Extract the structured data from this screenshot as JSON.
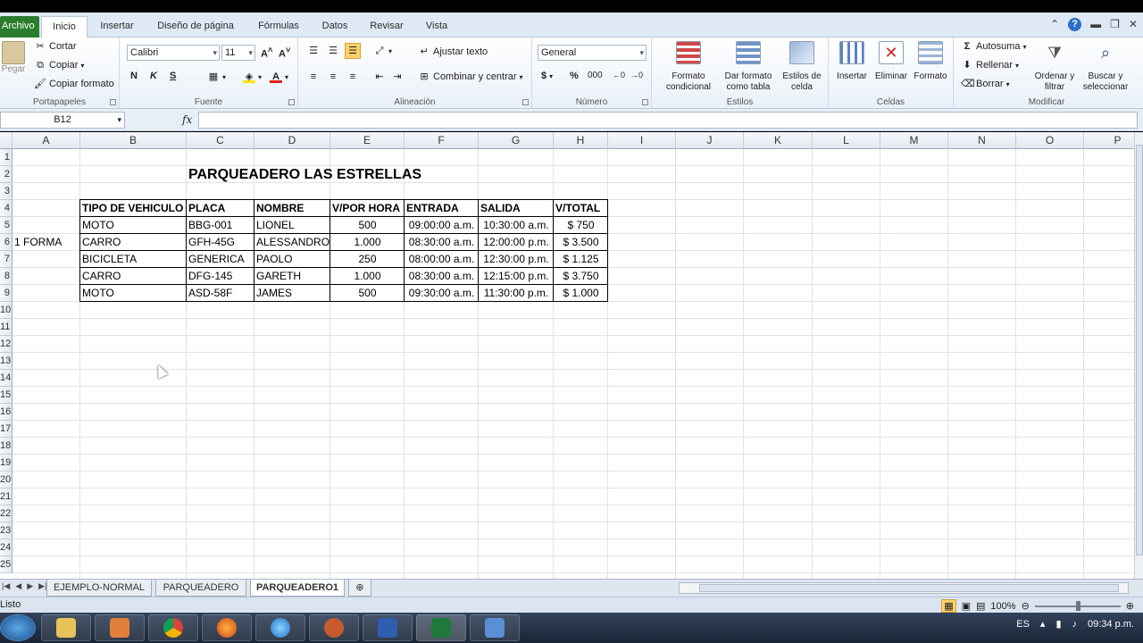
{
  "ribbon_tabs": {
    "file": "Archivo",
    "inicio": "Inicio",
    "insertar": "Insertar",
    "diseno": "Diseño de página",
    "formulas": "Fórmulas",
    "datos": "Datos",
    "revisar": "Revisar",
    "vista": "Vista"
  },
  "clipboard": {
    "paste": "Pegar",
    "cut": "Cortar",
    "copy": "Copiar",
    "format_painter": "Copiar formato",
    "label": "Portapapeles"
  },
  "font": {
    "name": "Calibri",
    "size": "11",
    "bold": "N",
    "italic": "K",
    "underline": "S",
    "label": "Fuente"
  },
  "alignment": {
    "wrap": "Ajustar texto",
    "merge": "Combinar y centrar",
    "label": "Alineación"
  },
  "number": {
    "format": "General",
    "currency": "$",
    "percent": "%",
    "thousands": "000",
    "label": "Número"
  },
  "styles": {
    "conditional": "Formato condicional",
    "as_table": "Dar formato como tabla",
    "cell_styles": "Estilos de celda",
    "label": "Estilos"
  },
  "cells": {
    "insert": "Insertar",
    "delete": "Eliminar",
    "format": "Formato",
    "label": "Celdas"
  },
  "editing": {
    "autosum": "Autosuma",
    "fill": "Rellenar",
    "clear": "Borrar",
    "sort": "Ordenar y filtrar",
    "find": "Buscar y seleccionar",
    "label": "Modificar"
  },
  "formula_bar": {
    "name_box": "B12",
    "fx": "fx",
    "content": ""
  },
  "columns": [
    "A",
    "B",
    "C",
    "D",
    "E",
    "F",
    "G",
    "H",
    "I",
    "J",
    "K",
    "L",
    "M",
    "N",
    "O",
    "P"
  ],
  "rows": [
    "1",
    "2",
    "3",
    "4",
    "5",
    "6",
    "7",
    "8",
    "9",
    "10",
    "11",
    "12",
    "13",
    "14",
    "15",
    "16",
    "17",
    "18",
    "19",
    "20",
    "21",
    "22",
    "23",
    "24",
    "25"
  ],
  "sheet": {
    "title": "PARQUEADERO LAS ESTRELLAS",
    "side_label": "1 FORMA",
    "headers": [
      "TIPO DE VEHICULO",
      "PLACA",
      "NOMBRE",
      "V/POR HORA",
      "ENTRADA",
      "SALIDA",
      "V/TOTAL"
    ],
    "data": [
      [
        "MOTO",
        "BBG-001",
        "LIONEL",
        "500",
        "09:00:00 a.m.",
        "10:30:00 a.m.",
        "$ 750"
      ],
      [
        "CARRO",
        "GFH-45G",
        "ALESSANDRO",
        "1.000",
        "08:30:00 a.m.",
        "12:00:00 p.m.",
        "$ 3.500"
      ],
      [
        "BICICLETA",
        "GENERICA",
        "PAOLO",
        "250",
        "08:00:00 a.m.",
        "12:30:00 p.m.",
        "$ 1.125"
      ],
      [
        "CARRO",
        "DFG-145",
        "GARETH",
        "1.000",
        "08:30:00 a.m.",
        "12:15:00 p.m.",
        "$ 3.750"
      ],
      [
        "MOTO",
        "ASD-58F",
        "JAMES",
        "500",
        "09:30:00 a.m.",
        "11:30:00 p.m.",
        "$ 1.000"
      ]
    ]
  },
  "sheet_tabs": [
    "EJEMPLO-NORMAL",
    "PARQUEADERO",
    "PARQUEADERO1"
  ],
  "active_sheet": "PARQUEADERO1",
  "status": {
    "mode": "Listo",
    "zoom": "100%"
  },
  "taskbar": {
    "lang": "ES",
    "time": "09:34 p.m."
  },
  "colors": {
    "file_tab": "#2a7d2e",
    "ribbon_bg": "#dfe9f5",
    "grid_line": "#e0e3e7"
  }
}
